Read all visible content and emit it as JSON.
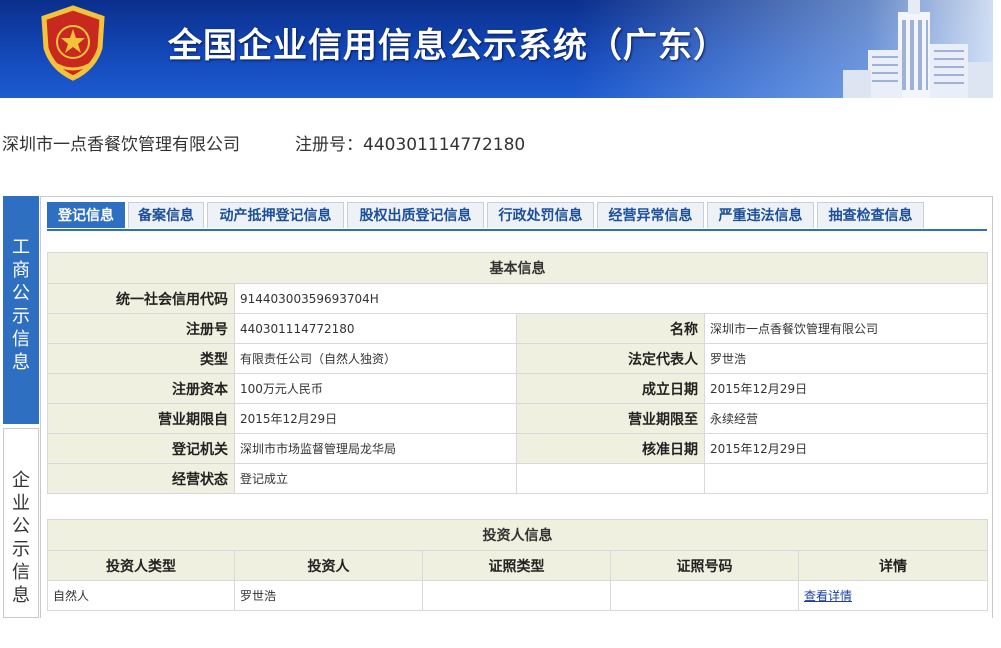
{
  "banner": {
    "title": "全国企业信用信息公示系统（广东）"
  },
  "company": {
    "name": "深圳市一点香餐饮管理有限公司",
    "reg_label": "注册号：440301114772180"
  },
  "side_tabs": [
    {
      "label": "工商公示信息",
      "chars": [
        "工",
        "商",
        "公",
        "示",
        "信",
        "息"
      ]
    },
    {
      "label": "企业公示信息",
      "chars": [
        "企",
        "业",
        "公",
        "示",
        "信",
        "息"
      ]
    }
  ],
  "tabs": [
    "登记信息",
    "备案信息",
    "动产抵押登记信息",
    "股权出质登记信息",
    "行政处罚信息",
    "经营异常信息",
    "严重违法信息",
    "抽查检查信息"
  ],
  "basic": {
    "caption": "基本信息",
    "credit_code_label": "统一社会信用代码",
    "credit_code": "91440300359693704H",
    "rows": [
      {
        "l1": "注册号",
        "v1": "440301114772180",
        "l2": "名称",
        "v2": "深圳市一点香餐饮管理有限公司"
      },
      {
        "l1": "类型",
        "v1": "有限责任公司（自然人独资）",
        "l2": "法定代表人",
        "v2": "罗世浩"
      },
      {
        "l1": "注册资本",
        "v1": "100万元人民币",
        "l2": "成立日期",
        "v2": "2015年12月29日"
      },
      {
        "l1": "营业期限自",
        "v1": "2015年12月29日",
        "l2": "营业期限至",
        "v2": "永续经营"
      },
      {
        "l1": "登记机关",
        "v1": "深圳市市场监督管理局龙华局",
        "l2": "核准日期",
        "v2": "2015年12月29日"
      },
      {
        "l1": "经营状态",
        "v1": "登记成立",
        "l2": "",
        "v2": ""
      }
    ]
  },
  "investor": {
    "caption": "投资人信息",
    "headers": [
      "投资人类型",
      "投资人",
      "证照类型",
      "证照号码",
      "详情"
    ],
    "rows": [
      {
        "type": "自然人",
        "name": "罗世浩",
        "id_type": "",
        "id_no": "",
        "detail": "查看详情"
      }
    ]
  },
  "colors": {
    "banner": "#1448b8",
    "tab_active": "#2e6fc2",
    "label_bg": "#f0f0e0",
    "link": "#1b3fa0"
  }
}
